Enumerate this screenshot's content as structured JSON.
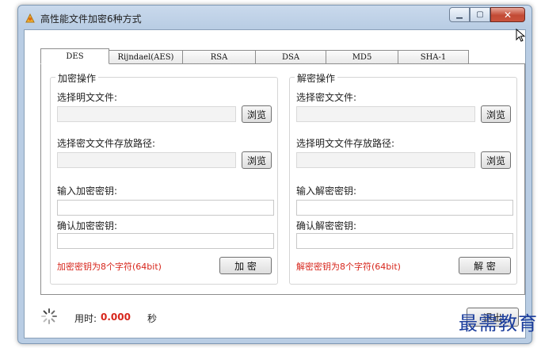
{
  "window": {
    "title": "高性能文件加密6种方式",
    "min_symbol": "▁",
    "max_symbol": "▢",
    "close_symbol": "✕"
  },
  "tabs": [
    {
      "label": "DES",
      "active": true
    },
    {
      "label": "Rijndael(AES)",
      "active": false
    },
    {
      "label": "RSA",
      "active": false
    },
    {
      "label": "DSA",
      "active": false
    },
    {
      "label": "MD5",
      "active": false
    },
    {
      "label": "SHA-1",
      "active": false
    }
  ],
  "encrypt": {
    "legend": "加密操作",
    "plain_file_label": "选择明文文件:",
    "plain_file_value": "",
    "browse1": "浏览",
    "cipher_path_label": "选择密文文件存放路径:",
    "cipher_path_value": "",
    "browse2": "浏览",
    "key_label": "输入加密密钥:",
    "key_value": "",
    "confirm_label": "确认加密密钥:",
    "confirm_value": "",
    "hint": "加密密钥为8个字符(64bit)",
    "action": "加 密"
  },
  "decrypt": {
    "legend": "解密操作",
    "cipher_file_label": "选择密文文件:",
    "cipher_file_value": "",
    "browse1": "浏览",
    "plain_path_label": "选择明文文件存放路径:",
    "plain_path_value": "",
    "browse2": "浏览",
    "key_label": "输入解密密钥:",
    "key_value": "",
    "confirm_label": "确认解密密钥:",
    "confirm_value": "",
    "hint": "解密密钥为8个字符(64bit)",
    "action": "解 密"
  },
  "status": {
    "time_label": "用时:",
    "time_value": "0.000",
    "time_unit": "秒",
    "exit_label": "退出"
  },
  "watermark": "最需教育",
  "colors": {
    "hint_red": "#d7261c",
    "watermark_blue": "#1b3d9c"
  }
}
